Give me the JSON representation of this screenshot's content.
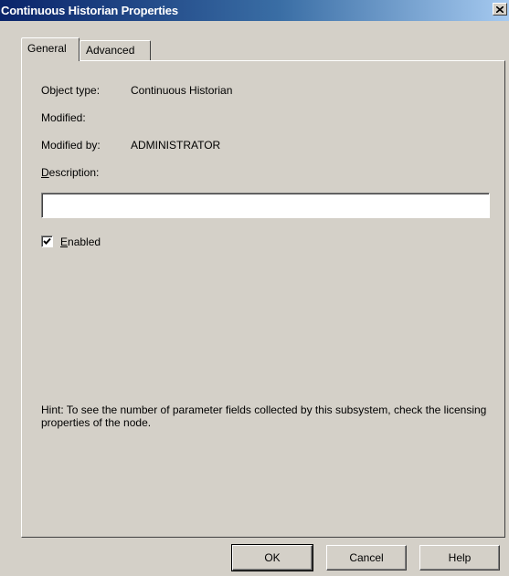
{
  "window": {
    "title": "Continuous Historian Properties"
  },
  "tabs": [
    {
      "label": "General",
      "active": true
    },
    {
      "label": "Advanced",
      "active": false
    }
  ],
  "general": {
    "object_type_label": "Object type:",
    "object_type_value": "Continuous Historian",
    "modified_label": "Modified:",
    "modified_value": "",
    "modified_by_label": "Modified by:",
    "modified_by_value": "ADMINISTRATOR",
    "description_label_mnemonic": "D",
    "description_label_rest": "escription:",
    "description_value": "",
    "enabled_label_mnemonic": "E",
    "enabled_label_rest": "nabled",
    "enabled_checked": true,
    "hint": "Hint: To see the number of parameter fields collected by this subsystem, check the licensing properties of the node."
  },
  "buttons": {
    "ok": "OK",
    "cancel": "Cancel",
    "help": "Help"
  },
  "colors": {
    "dialog_face": "#d4d0c8",
    "titlebar_start": "#0a246a",
    "titlebar_end": "#a6caf0"
  },
  "icons": {
    "close": "close-icon",
    "checkmark": "checkmark-icon"
  }
}
